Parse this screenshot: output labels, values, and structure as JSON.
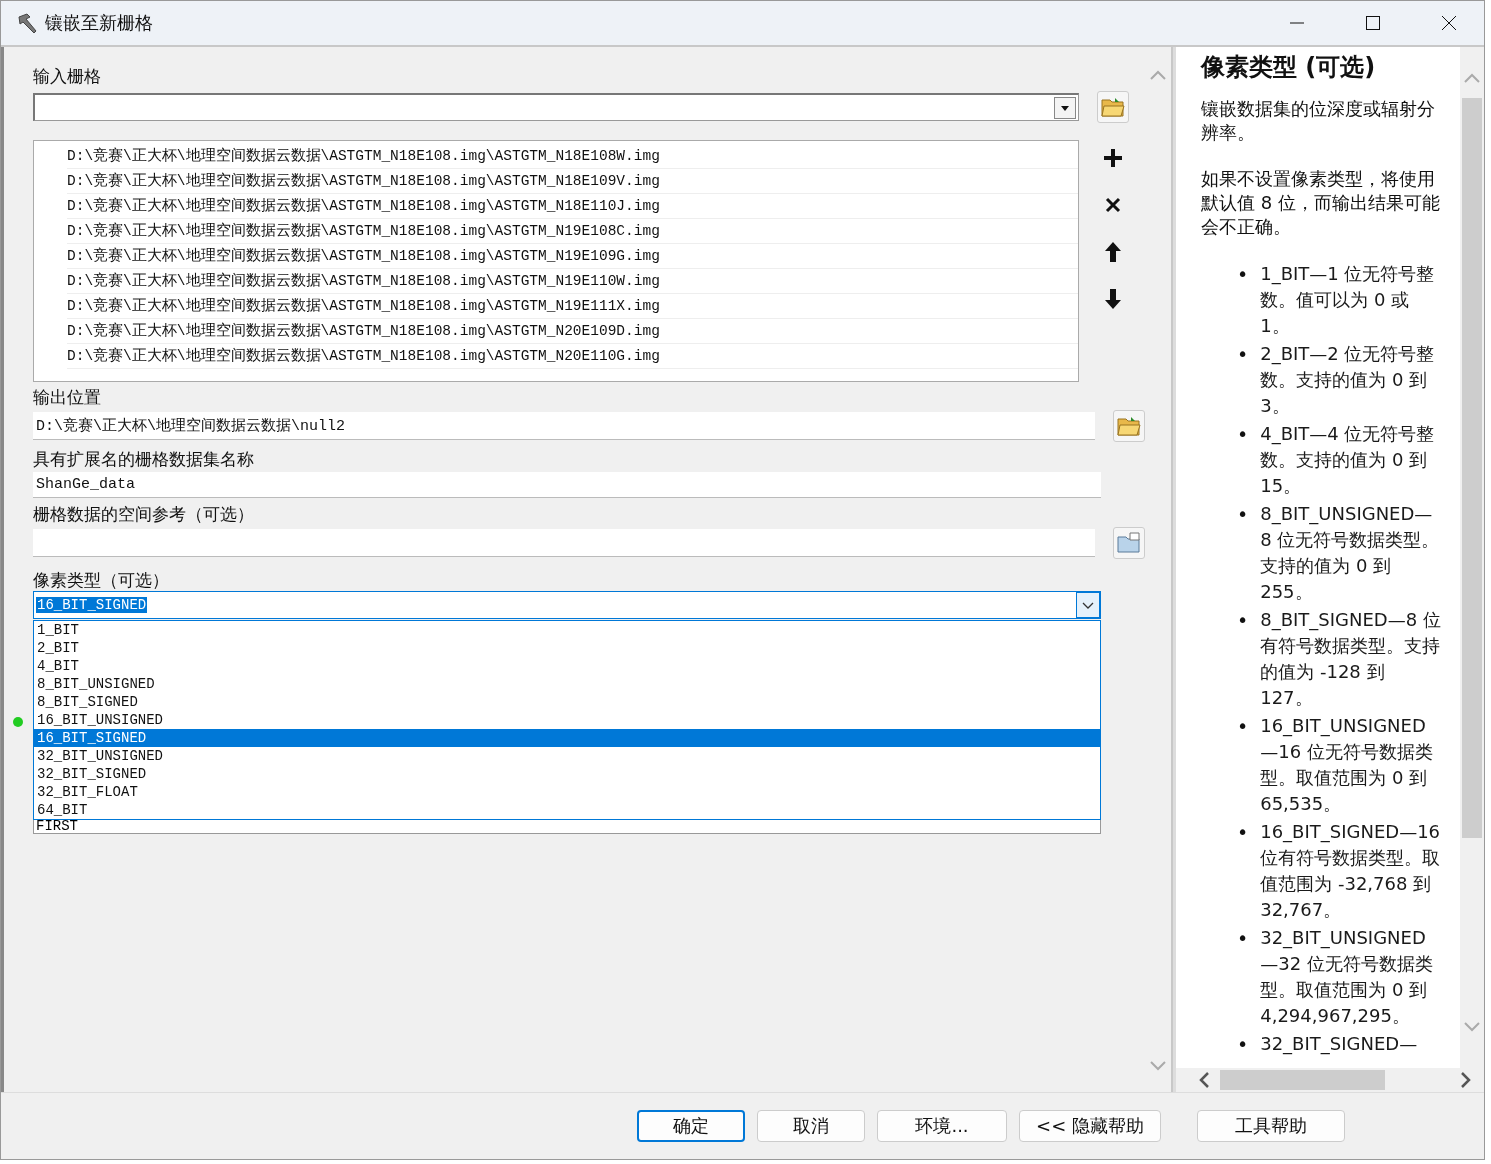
{
  "window": {
    "title": "镶嵌至新栅格"
  },
  "form": {
    "input_rasters": {
      "label": "输入栅格",
      "items": [
        "D:\\竞赛\\正大杯\\地理空间数据云数据\\ASTGTM_N18E108.img\\ASTGTM_N18E108W.img",
        "D:\\竞赛\\正大杯\\地理空间数据云数据\\ASTGTM_N18E108.img\\ASTGTM_N18E109V.img",
        "D:\\竞赛\\正大杯\\地理空间数据云数据\\ASTGTM_N18E108.img\\ASTGTM_N18E110J.img",
        "D:\\竞赛\\正大杯\\地理空间数据云数据\\ASTGTM_N18E108.img\\ASTGTM_N19E108C.img",
        "D:\\竞赛\\正大杯\\地理空间数据云数据\\ASTGTM_N18E108.img\\ASTGTM_N19E109G.img",
        "D:\\竞赛\\正大杯\\地理空间数据云数据\\ASTGTM_N18E108.img\\ASTGTM_N19E110W.img",
        "D:\\竞赛\\正大杯\\地理空间数据云数据\\ASTGTM_N18E108.img\\ASTGTM_N19E111X.img",
        "D:\\竞赛\\正大杯\\地理空间数据云数据\\ASTGTM_N18E108.img\\ASTGTM_N20E109D.img",
        "D:\\竞赛\\正大杯\\地理空间数据云数据\\ASTGTM_N18E108.img\\ASTGTM_N20E110G.img"
      ]
    },
    "output_location": {
      "label": "输出位置",
      "value": "D:\\竞赛\\正大杯\\地理空间数据云数据\\null2"
    },
    "dataset_name": {
      "label": "具有扩展名的栅格数据集名称",
      "value": "ShanGe_data"
    },
    "spatial_reference": {
      "label": "栅格数据的空间参考（可选）"
    },
    "pixel_type": {
      "label": "像素类型（可选）",
      "value": "16_BIT_SIGNED",
      "options": [
        {
          "label": "1_BIT",
          "selected": false
        },
        {
          "label": "2_BIT",
          "selected": false
        },
        {
          "label": "4_BIT",
          "selected": false
        },
        {
          "label": "8_BIT_UNSIGNED",
          "selected": false
        },
        {
          "label": "8_BIT_SIGNED",
          "selected": false
        },
        {
          "label": "16_BIT_UNSIGNED",
          "selected": false
        },
        {
          "label": "16_BIT_SIGNED",
          "selected": true
        },
        {
          "label": "32_BIT_UNSIGNED",
          "selected": false
        },
        {
          "label": "32_BIT_SIGNED",
          "selected": false
        },
        {
          "label": "32_BIT_FLOAT",
          "selected": false
        },
        {
          "label": "64_BIT",
          "selected": false
        }
      ]
    },
    "next_field": {
      "value": "FIRST"
    }
  },
  "help": {
    "title": "像素类型 (可选)",
    "paragraphs": [
      "镶嵌数据集的位深度或辐射分辨率。",
      "如果不设置像素类型，将使用默认值 8 位，而输出结果可能会不正确。"
    ],
    "bullets": [
      {
        "marker": "•",
        "text": "1_BIT—1 位无符号整数。值可以为 0 或 1。"
      },
      {
        "marker": "•",
        "text": "2_BIT—2 位无符号整数。支持的值为 0 到 3。"
      },
      {
        "marker": "•",
        "text": "4_BIT—4 位无符号整数。支持的值为 0 到 15。"
      },
      {
        "marker": "•",
        "text": "8_BIT_UNSIGNED—8 位无符号数据类型。支持的值为 0 到 255。"
      },
      {
        "marker": "•",
        "text": "8_BIT_SIGNED—8 位有符号数据类型。支持的值为 -128 到 127。"
      },
      {
        "marker": "•",
        "text": "16_BIT_UNSIGNED—16 位无符号数据类型。取值范围为 0 到 65,535。"
      },
      {
        "marker": "•",
        "text": "16_BIT_SIGNED—16 位有符号数据类型。取值范围为 -32,768 到 32,767。"
      },
      {
        "marker": "•",
        "text": "32_BIT_UNSIGNED—32 位无符号数据类型。取值范围为 0 到 4,294,967,295。"
      },
      {
        "marker": "•",
        "text": "32_BIT_SIGNED—"
      }
    ]
  },
  "buttons": [
    {
      "label": "确定",
      "focused": true
    },
    {
      "label": "取消",
      "focused": false
    },
    {
      "label": "环境...",
      "focused": false
    },
    {
      "label": "<< 隐藏帮助",
      "focused": false
    },
    {
      "label": "工具帮助",
      "focused": false
    }
  ]
}
